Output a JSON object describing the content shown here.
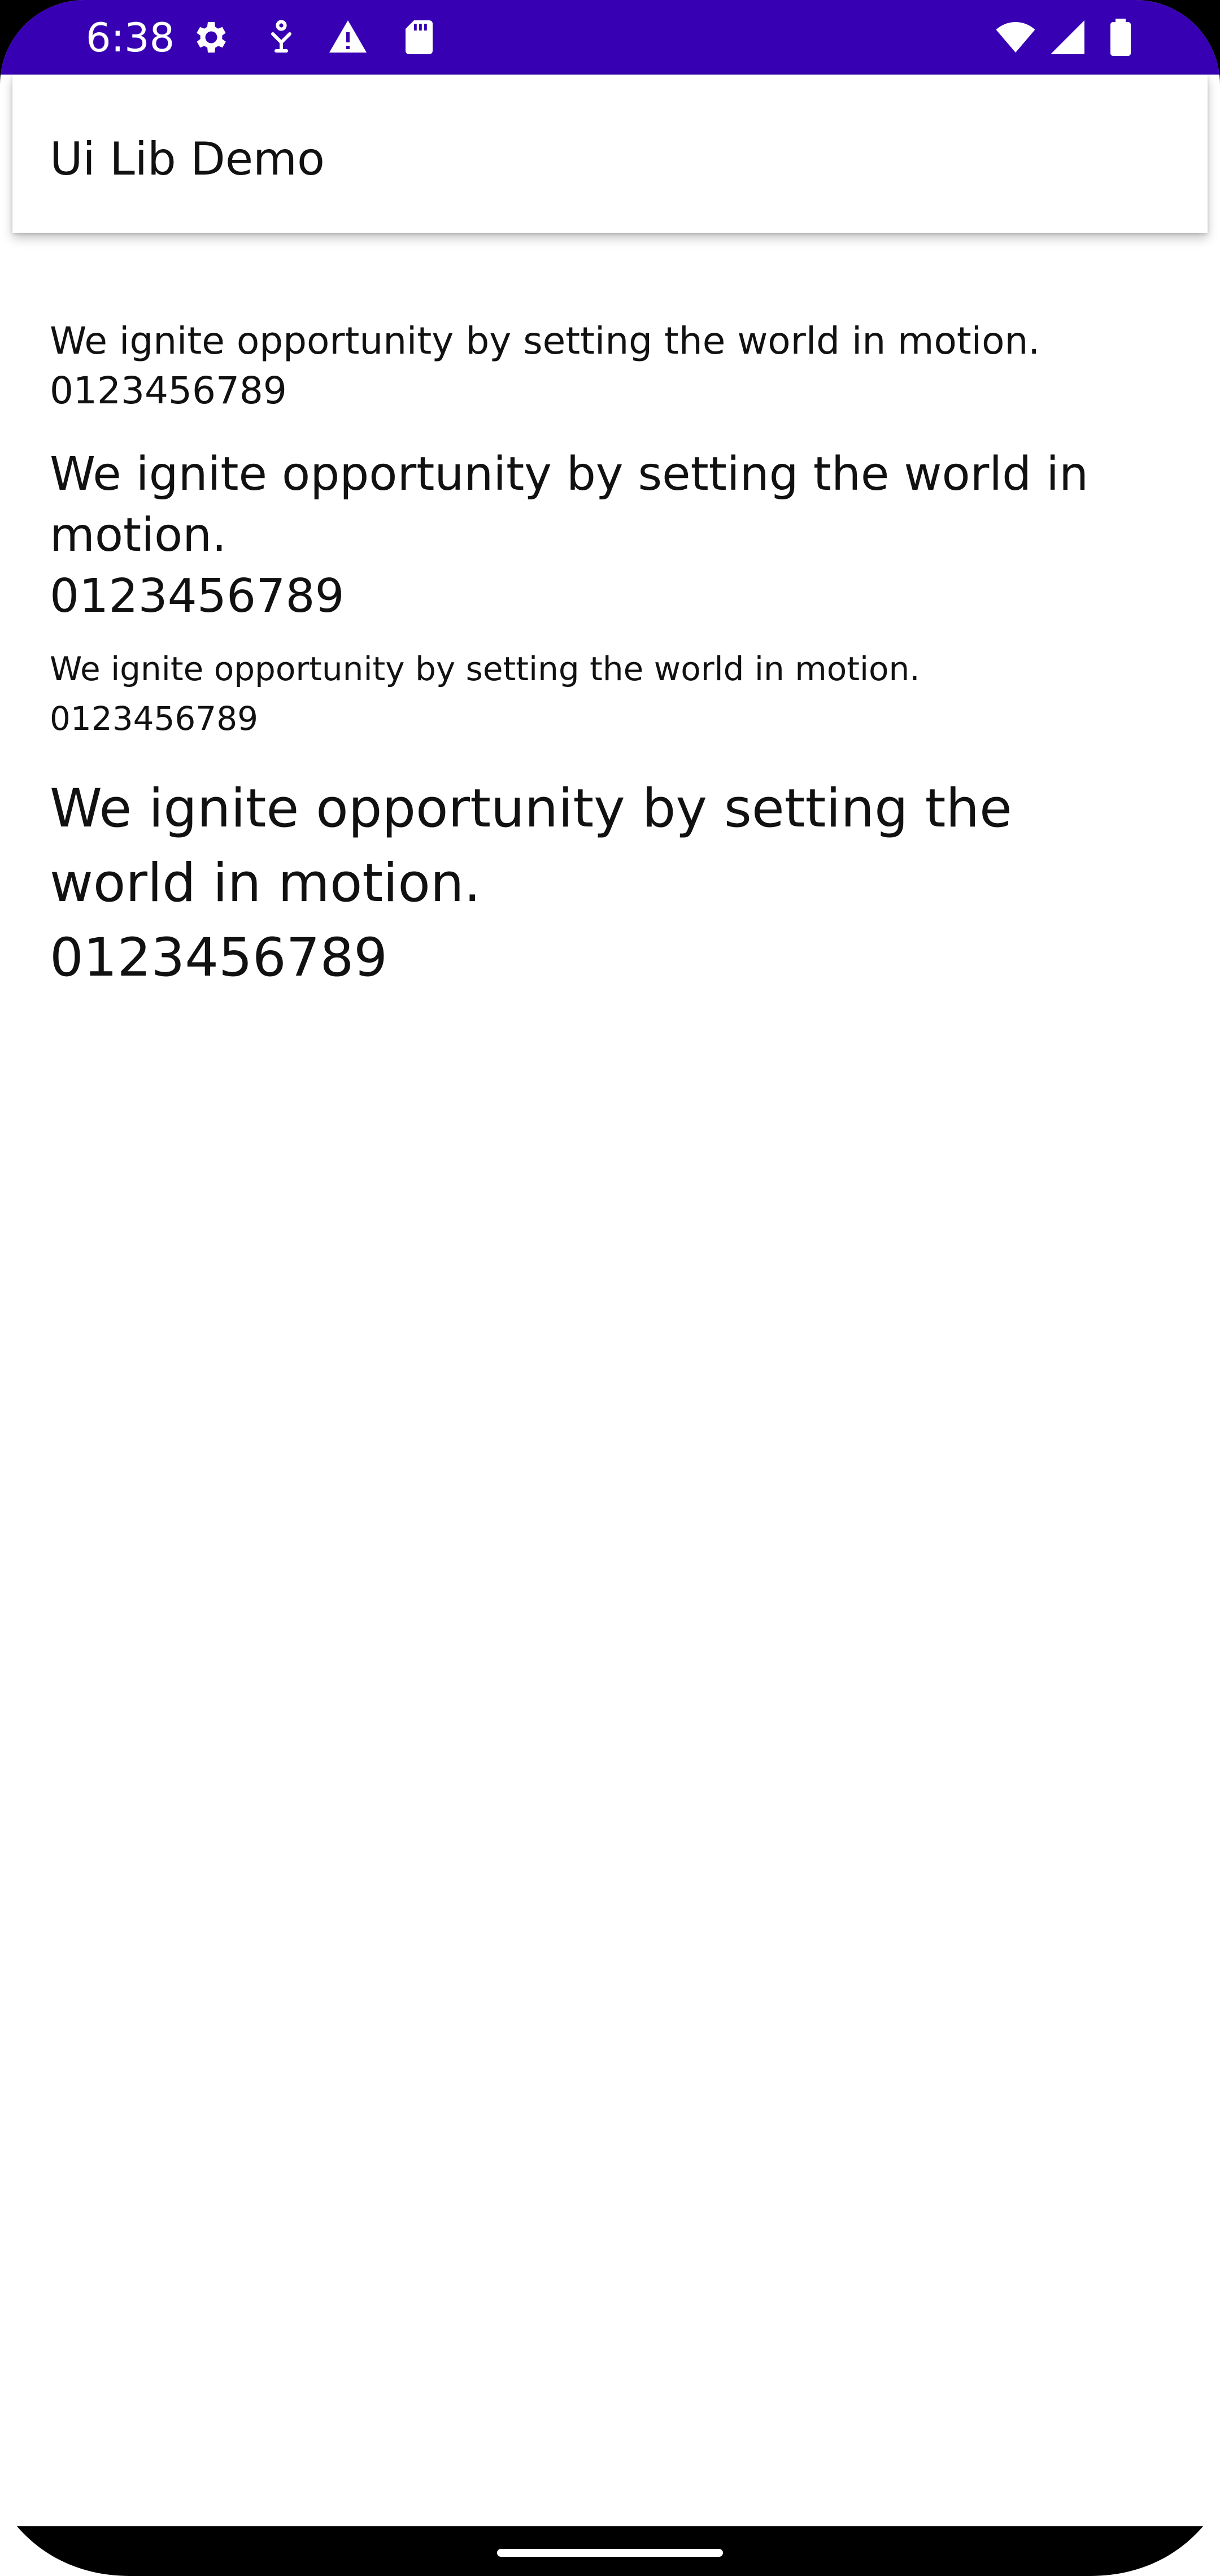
{
  "status_bar": {
    "time": "6:38",
    "icons_left": [
      "gear-icon",
      "accessibility-icon",
      "warning-icon",
      "sd-card-icon"
    ],
    "icons_right": [
      "wifi-icon",
      "cell-signal-icon",
      "battery-icon"
    ],
    "color": "#3700b3"
  },
  "app_bar": {
    "title": "Ui Lib Demo"
  },
  "content": {
    "blocks": [
      {
        "sentence": "We ignite opportunity by setting the world in motion.",
        "digits": "0123456789"
      },
      {
        "sentence": "We ignite opportunity by setting the world in motion.",
        "digits": "0123456789"
      },
      {
        "sentence": "We ignite opportunity by setting the world in motion.",
        "digits": "0123456789"
      },
      {
        "sentence": "We ignite opportunity by setting the world in motion.",
        "digits": "0123456789"
      }
    ]
  }
}
